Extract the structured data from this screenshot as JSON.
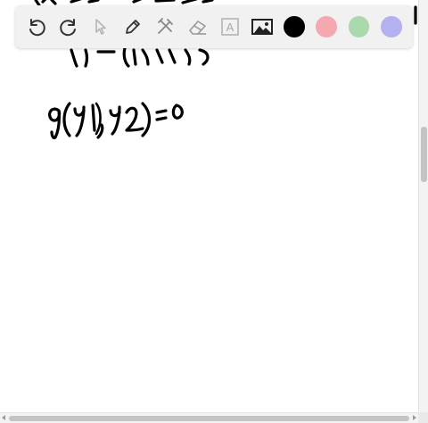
{
  "app": {
    "name": "whiteboard"
  },
  "toolbar": {
    "tools": [
      {
        "icon": "undo-icon"
      },
      {
        "icon": "redo-icon"
      },
      {
        "icon": "pointer-icon"
      },
      {
        "icon": "pen-icon"
      },
      {
        "icon": "tools-icon"
      },
      {
        "icon": "eraser-icon"
      },
      {
        "icon": "text-tool-icon",
        "glyph": "A"
      },
      {
        "icon": "image-icon"
      }
    ],
    "colors": {
      "black": "#000000",
      "red": "#f4a9b0",
      "green": "#a9d9ad",
      "blue": "#b3b1f0"
    }
  },
  "canvas": {
    "handwriting": [
      "g(y1,y2)=0"
    ]
  }
}
